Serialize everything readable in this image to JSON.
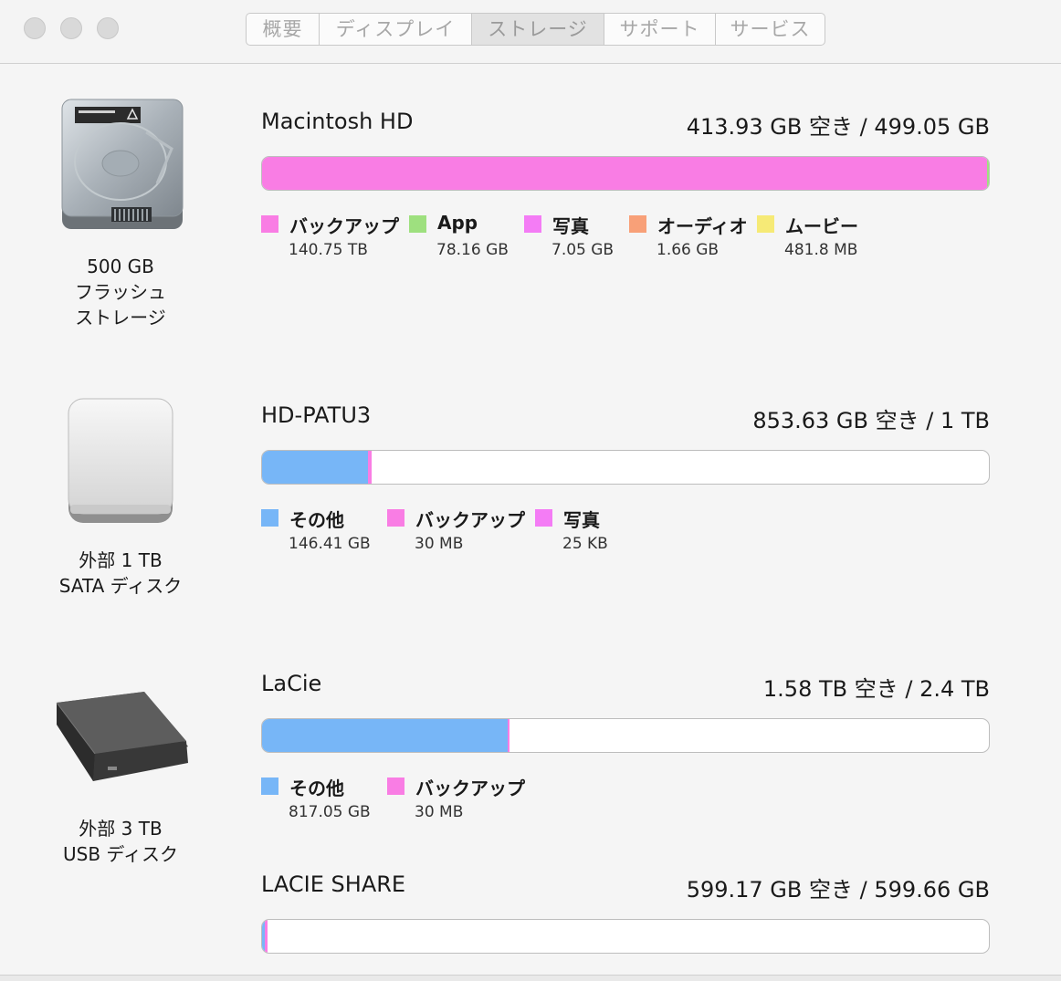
{
  "window": {
    "tabs": [
      {
        "label": "概要"
      },
      {
        "label": "ディスプレイ"
      },
      {
        "label": "ストレージ"
      },
      {
        "label": "サポート"
      },
      {
        "label": "サービス"
      }
    ],
    "active_tab": "ストレージ"
  },
  "devices": [
    {
      "label_lines": [
        "500 GB",
        "フラッシュ",
        "ストレージ"
      ],
      "icon": "internal-hard-drive-icon",
      "volumes": [
        {
          "name": "Macintosh HD",
          "free": "413.93 GB 空き / 499.05 GB",
          "segments": [
            {
              "category": "バックアップ",
              "fraction": 0.997,
              "color": "#f97de4"
            },
            {
              "category": "App",
              "fraction": 0.003,
              "color": "#9ee07f"
            }
          ],
          "legend": [
            {
              "name": "バックアップ",
              "size": "140.75 TB",
              "color": "#f97de4"
            },
            {
              "name": "App",
              "size": "78.16 GB",
              "color": "#9ee07f"
            },
            {
              "name": "写真",
              "size": "7.05 GB",
              "color": "#f47cf5"
            },
            {
              "name": "オーディオ",
              "size": "1.66 GB",
              "color": "#f8a078"
            },
            {
              "name": "ムービー",
              "size": "481.8 MB",
              "color": "#f6ea76"
            }
          ]
        }
      ]
    },
    {
      "label_lines": [
        "外部 1 TB",
        "SATA ディスク"
      ],
      "icon": "external-drive-icon",
      "volumes": [
        {
          "name": "HD-PATU3",
          "free": "853.63 GB 空き / 1 TB",
          "segments": [
            {
              "category": "その他",
              "fraction": 0.146,
              "color": "#77b6f7"
            },
            {
              "category": "バックアップ",
              "fraction": 0.005,
              "color": "#f97de4"
            }
          ],
          "legend": [
            {
              "name": "その他",
              "size": "146.41 GB",
              "color": "#77b6f7"
            },
            {
              "name": "バックアップ",
              "size": "30 MB",
              "color": "#f97de4"
            },
            {
              "name": "写真",
              "size": "25 KB",
              "color": "#f47cf5"
            }
          ]
        }
      ]
    },
    {
      "label_lines": [
        "外部 3 TB",
        "USB ディスク"
      ],
      "icon": "lacie-usb-drive-icon",
      "volumes": [
        {
          "name": "LaCie",
          "free": "1.58 TB 空き / 2.4 TB",
          "segments": [
            {
              "category": "その他",
              "fraction": 0.338,
              "color": "#77b6f7"
            },
            {
              "category": "バックアップ",
              "fraction": 0.003,
              "color": "#f97de4"
            }
          ],
          "legend": [
            {
              "name": "その他",
              "size": "817.05 GB",
              "color": "#77b6f7"
            },
            {
              "name": "バックアップ",
              "size": "30 MB",
              "color": "#f97de4"
            }
          ]
        },
        {
          "name": "LACIE SHARE",
          "free": "599.17 GB 空き / 599.66 GB",
          "segments": [
            {
              "category": "その他",
              "fraction": 0.004,
              "color": "#77b6f7"
            },
            {
              "category": "バックアップ",
              "fraction": 0.004,
              "color": "#f97de4"
            }
          ],
          "legend": []
        }
      ]
    }
  ]
}
